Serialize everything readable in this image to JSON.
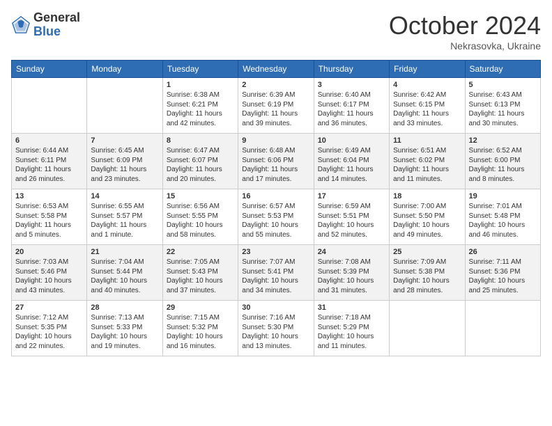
{
  "header": {
    "logo_general": "General",
    "logo_blue": "Blue",
    "month": "October 2024",
    "location": "Nekrasovka, Ukraine"
  },
  "weekdays": [
    "Sunday",
    "Monday",
    "Tuesday",
    "Wednesday",
    "Thursday",
    "Friday",
    "Saturday"
  ],
  "weeks": [
    [
      {
        "day": "",
        "content": ""
      },
      {
        "day": "",
        "content": ""
      },
      {
        "day": "1",
        "content": "Sunrise: 6:38 AM\nSunset: 6:21 PM\nDaylight: 11 hours and 42 minutes."
      },
      {
        "day": "2",
        "content": "Sunrise: 6:39 AM\nSunset: 6:19 PM\nDaylight: 11 hours and 39 minutes."
      },
      {
        "day": "3",
        "content": "Sunrise: 6:40 AM\nSunset: 6:17 PM\nDaylight: 11 hours and 36 minutes."
      },
      {
        "day": "4",
        "content": "Sunrise: 6:42 AM\nSunset: 6:15 PM\nDaylight: 11 hours and 33 minutes."
      },
      {
        "day": "5",
        "content": "Sunrise: 6:43 AM\nSunset: 6:13 PM\nDaylight: 11 hours and 30 minutes."
      }
    ],
    [
      {
        "day": "6",
        "content": "Sunrise: 6:44 AM\nSunset: 6:11 PM\nDaylight: 11 hours and 26 minutes."
      },
      {
        "day": "7",
        "content": "Sunrise: 6:45 AM\nSunset: 6:09 PM\nDaylight: 11 hours and 23 minutes."
      },
      {
        "day": "8",
        "content": "Sunrise: 6:47 AM\nSunset: 6:07 PM\nDaylight: 11 hours and 20 minutes."
      },
      {
        "day": "9",
        "content": "Sunrise: 6:48 AM\nSunset: 6:06 PM\nDaylight: 11 hours and 17 minutes."
      },
      {
        "day": "10",
        "content": "Sunrise: 6:49 AM\nSunset: 6:04 PM\nDaylight: 11 hours and 14 minutes."
      },
      {
        "day": "11",
        "content": "Sunrise: 6:51 AM\nSunset: 6:02 PM\nDaylight: 11 hours and 11 minutes."
      },
      {
        "day": "12",
        "content": "Sunrise: 6:52 AM\nSunset: 6:00 PM\nDaylight: 11 hours and 8 minutes."
      }
    ],
    [
      {
        "day": "13",
        "content": "Sunrise: 6:53 AM\nSunset: 5:58 PM\nDaylight: 11 hours and 5 minutes."
      },
      {
        "day": "14",
        "content": "Sunrise: 6:55 AM\nSunset: 5:57 PM\nDaylight: 11 hours and 1 minute."
      },
      {
        "day": "15",
        "content": "Sunrise: 6:56 AM\nSunset: 5:55 PM\nDaylight: 10 hours and 58 minutes."
      },
      {
        "day": "16",
        "content": "Sunrise: 6:57 AM\nSunset: 5:53 PM\nDaylight: 10 hours and 55 minutes."
      },
      {
        "day": "17",
        "content": "Sunrise: 6:59 AM\nSunset: 5:51 PM\nDaylight: 10 hours and 52 minutes."
      },
      {
        "day": "18",
        "content": "Sunrise: 7:00 AM\nSunset: 5:50 PM\nDaylight: 10 hours and 49 minutes."
      },
      {
        "day": "19",
        "content": "Sunrise: 7:01 AM\nSunset: 5:48 PM\nDaylight: 10 hours and 46 minutes."
      }
    ],
    [
      {
        "day": "20",
        "content": "Sunrise: 7:03 AM\nSunset: 5:46 PM\nDaylight: 10 hours and 43 minutes."
      },
      {
        "day": "21",
        "content": "Sunrise: 7:04 AM\nSunset: 5:44 PM\nDaylight: 10 hours and 40 minutes."
      },
      {
        "day": "22",
        "content": "Sunrise: 7:05 AM\nSunset: 5:43 PM\nDaylight: 10 hours and 37 minutes."
      },
      {
        "day": "23",
        "content": "Sunrise: 7:07 AM\nSunset: 5:41 PM\nDaylight: 10 hours and 34 minutes."
      },
      {
        "day": "24",
        "content": "Sunrise: 7:08 AM\nSunset: 5:39 PM\nDaylight: 10 hours and 31 minutes."
      },
      {
        "day": "25",
        "content": "Sunrise: 7:09 AM\nSunset: 5:38 PM\nDaylight: 10 hours and 28 minutes."
      },
      {
        "day": "26",
        "content": "Sunrise: 7:11 AM\nSunset: 5:36 PM\nDaylight: 10 hours and 25 minutes."
      }
    ],
    [
      {
        "day": "27",
        "content": "Sunrise: 7:12 AM\nSunset: 5:35 PM\nDaylight: 10 hours and 22 minutes."
      },
      {
        "day": "28",
        "content": "Sunrise: 7:13 AM\nSunset: 5:33 PM\nDaylight: 10 hours and 19 minutes."
      },
      {
        "day": "29",
        "content": "Sunrise: 7:15 AM\nSunset: 5:32 PM\nDaylight: 10 hours and 16 minutes."
      },
      {
        "day": "30",
        "content": "Sunrise: 7:16 AM\nSunset: 5:30 PM\nDaylight: 10 hours and 13 minutes."
      },
      {
        "day": "31",
        "content": "Sunrise: 7:18 AM\nSunset: 5:29 PM\nDaylight: 10 hours and 11 minutes."
      },
      {
        "day": "",
        "content": ""
      },
      {
        "day": "",
        "content": ""
      }
    ]
  ]
}
